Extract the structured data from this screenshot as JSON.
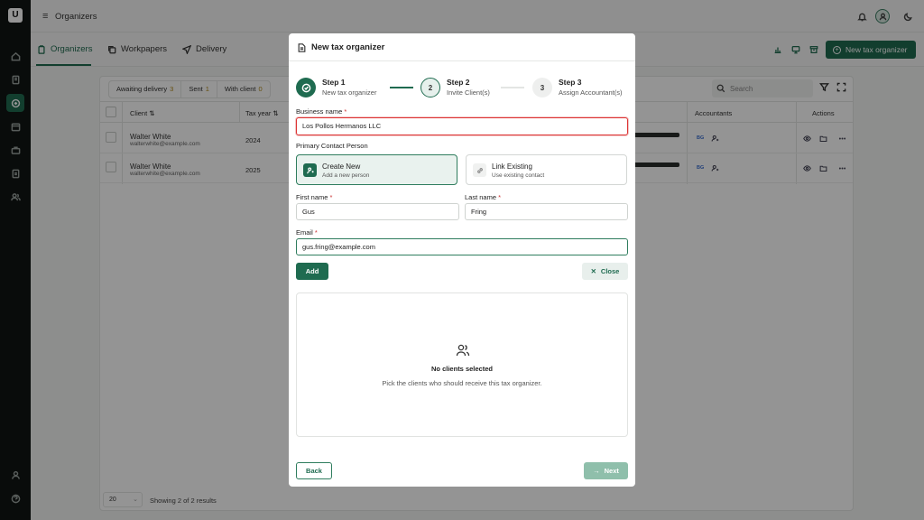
{
  "app": {
    "logo_letter": "U",
    "page_title": "Organizers"
  },
  "tabs": [
    {
      "label": "Organizers",
      "icon": "clipboard-icon"
    },
    {
      "label": "Workpapers",
      "icon": "copy-icon"
    },
    {
      "label": "Delivery",
      "icon": "send-icon"
    }
  ],
  "toolbar": {
    "new_organizer_label": "New tax organizer"
  },
  "table": {
    "filters": [
      {
        "label": "Awaiting delivery",
        "count": "3"
      },
      {
        "label": "Sent",
        "count": "1"
      },
      {
        "label": "With client",
        "count": "0"
      }
    ],
    "search_placeholder": "Search",
    "columns": [
      "Client ⇅",
      "Tax year ⇅",
      "Accountants",
      "Actions"
    ],
    "rows": [
      {
        "name": "Walter White",
        "email": "walterwhite@example.com",
        "year": "2024",
        "badge": "BG"
      },
      {
        "name": "Walter White",
        "email": "walterwhite@example.com",
        "year": "2025",
        "badge": "BG"
      }
    ],
    "page_size": "20",
    "summary": "Showing 2 of 2 results"
  },
  "modal": {
    "title": "New tax organizer",
    "steps": [
      {
        "number": "1",
        "title": "Step 1",
        "subtitle": "New tax organizer",
        "status": "done"
      },
      {
        "number": "2",
        "title": "Step 2",
        "subtitle": "Invite Client(s)",
        "status": "active"
      },
      {
        "number": "3",
        "title": "Step 3",
        "subtitle": "Assign Accountant(s)",
        "status": "todo"
      }
    ],
    "business_name_label": "Business name",
    "business_name_value": "Los Pollos Hermanos LLC",
    "primary_contact_label": "Primary Contact Person",
    "options": [
      {
        "title": "Create New",
        "subtitle": "Add a new person",
        "selected": true
      },
      {
        "title": "Link Existing",
        "subtitle": "Use existing contact",
        "selected": false
      }
    ],
    "first_name_label": "First name",
    "first_name_value": "Gus",
    "last_name_label": "Last name",
    "last_name_value": "Fring",
    "email_label": "Email",
    "email_value": "gus.fring@example.com",
    "required_mark": "*",
    "add_label": "Add",
    "close_label": "Close",
    "empty_title": "No clients selected",
    "empty_subtitle": "Pick the clients who should receive this tax organizer.",
    "back_label": "Back",
    "next_label": "Next"
  },
  "colors": {
    "primary": "#1f6b50",
    "error": "#dd3333",
    "next_disabled": "#8fbfab"
  }
}
